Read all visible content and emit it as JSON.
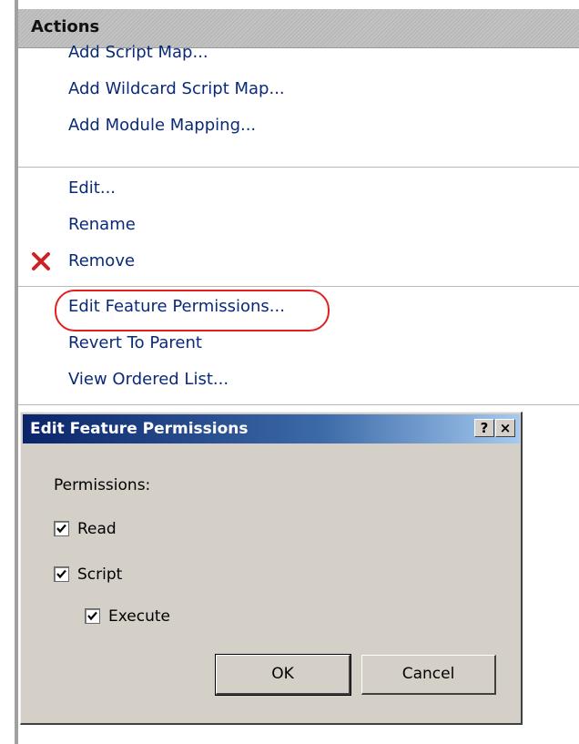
{
  "actions": {
    "header": "Actions",
    "groups": [
      [
        "Add Script Map...",
        "Add Wildcard Script Map...",
        "Add Module Mapping..."
      ],
      [
        "Edit...",
        "Rename",
        "Remove"
      ],
      [
        "Edit Feature Permissions...",
        "Revert To Parent",
        "View Ordered List..."
      ]
    ]
  },
  "dialog": {
    "title": "Edit Feature Permissions",
    "help_button": "?",
    "close_button": "×",
    "permissions_label": "Permissions:",
    "checkboxes": [
      {
        "label": "Read",
        "checked": true
      },
      {
        "label": "Script",
        "checked": true
      },
      {
        "label": "Execute",
        "checked": true
      }
    ],
    "ok_label": "OK",
    "cancel_label": "Cancel"
  },
  "colors": {
    "link": "#0a2a78",
    "highlight": "#e02020",
    "remove_icon": "#cc2222",
    "titlebar_start": "#0a246a",
    "titlebar_end": "#a6caf0"
  },
  "icons": {
    "remove": "red-x-icon",
    "checkmark": "check-icon"
  }
}
